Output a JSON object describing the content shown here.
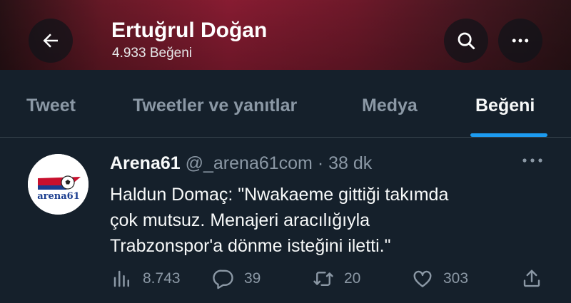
{
  "header": {
    "title": "Ertuğrul Doğan",
    "subtitle": "4.933 Beğeni"
  },
  "tabs": [
    {
      "label": "Tweet",
      "active": false
    },
    {
      "label": "Tweetler ve yanıtlar",
      "active": false
    },
    {
      "label": "Medya",
      "active": false
    },
    {
      "label": "Beğeni",
      "active": true
    }
  ],
  "tweet": {
    "name": "Arena61",
    "handle": "@_arena61com",
    "separator": "·",
    "time": "38 dk",
    "text_lines": [
      "Haldun Domaç: \"Nwakaeme gittiği takımda",
      "çok mutsuz. Menajeri aracılığıyla",
      "Trabzonspor'a dönme isteğini iletti.\""
    ],
    "avatar_label": "arena61",
    "stats": {
      "views": "8.743",
      "replies": "39",
      "retweets": "20",
      "likes": "303"
    }
  },
  "colors": {
    "background": "#15202b",
    "accent": "#1d9bf0",
    "muted": "#8b98a5",
    "header_brand": "#8e1d34"
  },
  "icons": [
    "back-arrow-icon",
    "search-icon",
    "more-icon",
    "views-icon",
    "reply-icon",
    "retweet-icon",
    "like-icon",
    "share-icon"
  ]
}
